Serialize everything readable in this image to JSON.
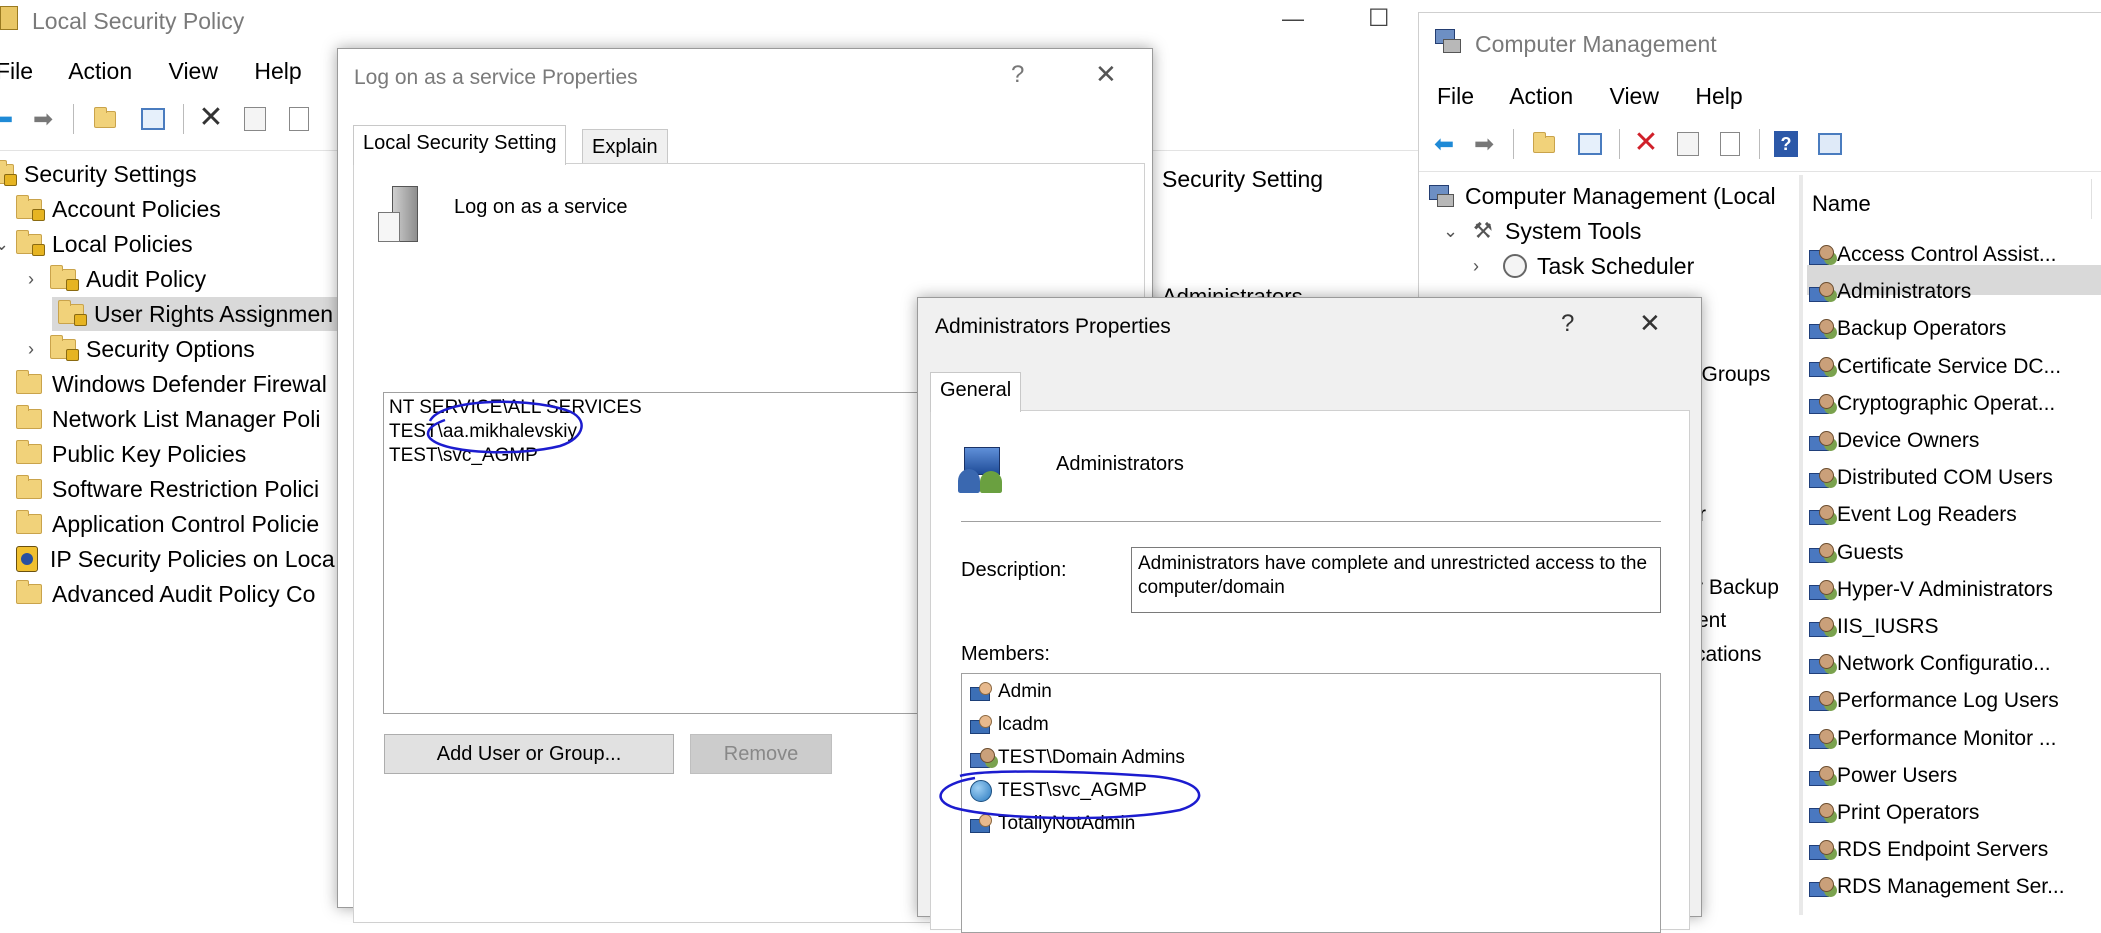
{
  "local_security_policy": {
    "title": "Local Security Policy",
    "menu": [
      "File",
      "Action",
      "View",
      "Help"
    ],
    "tree": {
      "root": "Security Settings",
      "items": [
        "Account Policies",
        "Local Policies",
        "Audit Policy",
        "User Rights Assignmen",
        "Security Options",
        "Windows Defender Firewal",
        "Network List Manager Poli",
        "Public Key Policies",
        "Software Restriction Polici",
        "Application Control Policie",
        "IP Security Policies on Loca",
        "Advanced Audit Policy Co"
      ]
    },
    "column_header": "Security Setting",
    "peek_value": "Administrators",
    "window_controls": {
      "minimize": "—",
      "maximize": "☐"
    }
  },
  "logon_dialog": {
    "title": "Log on as a service Properties",
    "help": "?",
    "close": "✕",
    "tabs": [
      "Local Security Setting",
      "Explain"
    ],
    "policy_name": "Log on as a service",
    "members": [
      "NT SERVICE\\ALL SERVICES",
      "TEST\\aa.mikhalevskiy",
      "TEST\\svc_AGMP"
    ],
    "add_button": "Add User or Group...",
    "remove_button": "Remove"
  },
  "admins_dialog": {
    "title": "Administrators Properties",
    "help": "?",
    "close": "✕",
    "tab": "General",
    "group_name": "Administrators",
    "description_label": "Description:",
    "description_value": "Administrators have complete and unrestricted access to the computer/domain",
    "members_label": "Members:",
    "members": [
      "Admin",
      "lcadm",
      "TEST\\Domain Admins",
      "TEST\\svc_AGMP",
      "TotallyNotAdmin"
    ]
  },
  "computer_management": {
    "title": "Computer Management",
    "menu": [
      "File",
      "Action",
      "View",
      "Help"
    ],
    "tree": {
      "root": "Computer Management (Local",
      "system_tools": "System Tools",
      "task_scheduler": "Task Scheduler"
    },
    "peek_fragments": [
      "l Groups",
      "r",
      "r Backup",
      "ent",
      "cations"
    ],
    "column_header": "Name",
    "groups": [
      "Access Control Assist...",
      "Administrators",
      "Backup Operators",
      "Certificate Service DC...",
      "Cryptographic Operat...",
      "Device Owners",
      "Distributed COM Users",
      "Event Log Readers",
      "Guests",
      "Hyper-V Administrators",
      "IIS_IUSRS",
      "Network Configuratio...",
      "Performance Log Users",
      "Performance Monitor ...",
      "Power Users",
      "Print Operators",
      "RDS Endpoint Servers",
      "RDS Management Ser..."
    ]
  },
  "colors": {
    "annotation": "#1c1ccf",
    "selection": "#cce8ff",
    "selected_row": "#d9d9d9",
    "nav_arrow": "#1f8ad6",
    "delete_red": "#d0202a"
  }
}
